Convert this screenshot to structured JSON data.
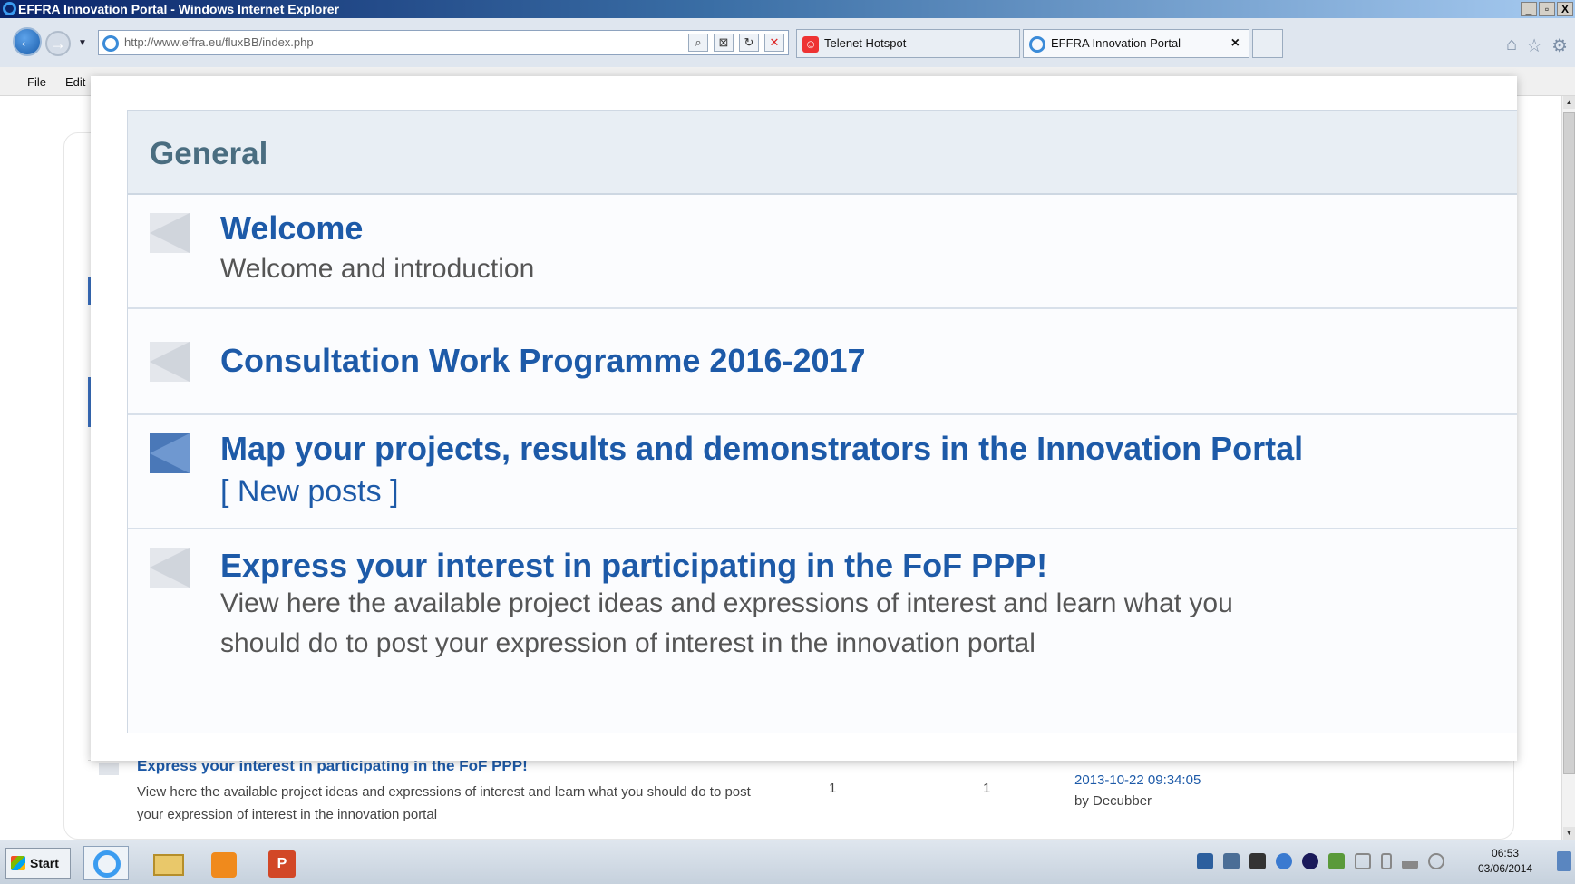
{
  "window": {
    "title": "EFFRA Innovation Portal - Windows Internet Explorer",
    "controls": [
      "_",
      "▫",
      "X"
    ]
  },
  "nav": {
    "url": "http://www.effra.eu/fluxBB/index.php",
    "tabs": [
      {
        "label": "Telenet Hotspot"
      },
      {
        "label": "EFFRA Innovation Portal",
        "close": "×"
      }
    ],
    "icons": [
      "home-icon",
      "favorites-icon",
      "tools-icon"
    ]
  },
  "menu": {
    "items": [
      "File",
      "Edit"
    ]
  },
  "overlay": {
    "category": "General",
    "forums": [
      {
        "title": "Welcome",
        "description": "Welcome and introduction",
        "has_new": false
      },
      {
        "title": "Consultation Work Programme 2016-2017",
        "description": "",
        "has_new": false
      },
      {
        "title": "Map your projects, results and demonstrators in the Innovation Portal",
        "new_posts": "[ New posts ]",
        "description": "",
        "has_new": true
      },
      {
        "title": "Express your interest in participating in the FoF PPP!",
        "description": "View here the available project ideas and expressions of interest and learn what you should do to post your expression of interest in the innovation portal",
        "has_new": false
      }
    ]
  },
  "background_row": {
    "title": "Express your interest in participating in the FoF PPP!",
    "description": "View here the available project ideas and expressions of interest and learn what you should do to post your expression of interest in the innovation portal",
    "topics": "1",
    "posts": "1",
    "last_post_date": "2013-10-22 09:34:05",
    "last_post_by": "by Decubber"
  },
  "taskbar": {
    "start_label": "Start",
    "apps": [
      "internet-explorer-icon",
      "folder-icon",
      "media-player-icon",
      "powerpoint-icon"
    ],
    "clock_time": "06:53",
    "clock_date": "03/06/2014",
    "colors": {
      "accent": "#1d5aa8",
      "header_text": "#4a6d80"
    }
  }
}
